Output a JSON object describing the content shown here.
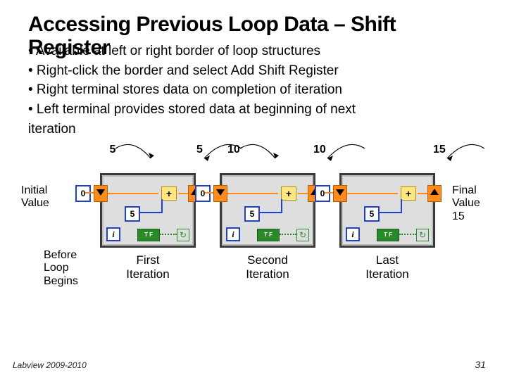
{
  "title_line1": "Accessing Previous Loop Data – Shift",
  "title_line2": "Register",
  "bullets": {
    "b1": "• Available at left or right border of loop structures",
    "b2": "• Right-click the border and select Add Shift Register",
    "b3": "• Right terminal stores data on completion of iteration",
    "b4": "• Left terminal provides stored data at beginning of next",
    "b4c": "iteration"
  },
  "labels": {
    "initial": "Initial\nValue",
    "final1": "Final",
    "final2": "Value",
    "final3": "15",
    "before": "Before\nLoop\nBegins",
    "first": "First\nIteration",
    "second": "Second\nIteration",
    "last": "Last\nIteration"
  },
  "consts": {
    "zero": "0",
    "five": "5",
    "plus": "+",
    "i": "i",
    "tf": "T F",
    "cyc": "↻"
  },
  "flows": {
    "a": "5",
    "b": "5",
    "c": "10",
    "d": "10",
    "e": "15"
  },
  "footer": {
    "left": "Labview 2009-2010",
    "right": "31"
  }
}
